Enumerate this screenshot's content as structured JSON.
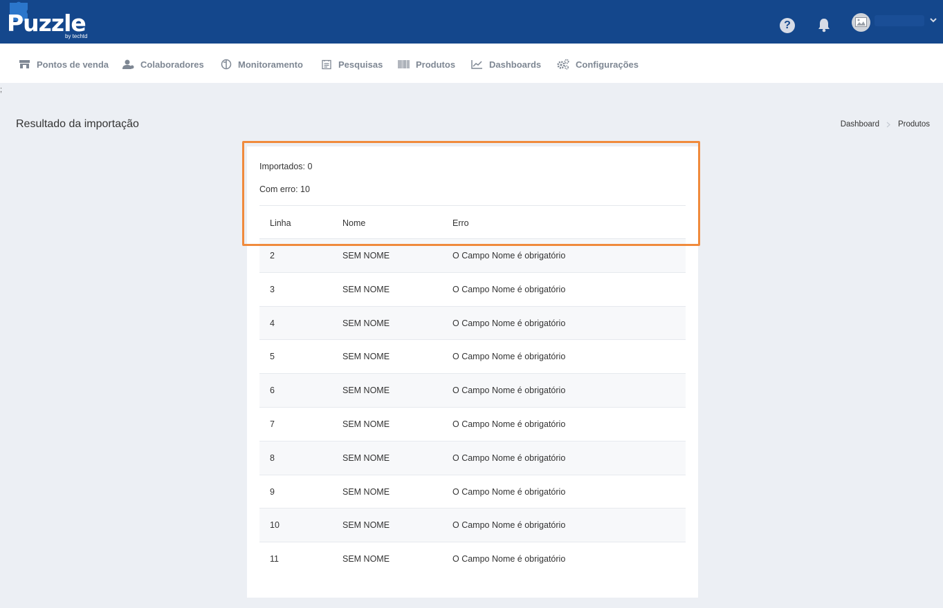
{
  "brand": {
    "name": "Puzzle",
    "tagline": "by techtd",
    "header_color": "#14478c",
    "accent_color": "#f08a3c"
  },
  "header": {
    "help_label": "?"
  },
  "nav": {
    "items": [
      {
        "label": "Pontos de venda",
        "icon": "store-icon"
      },
      {
        "label": "Colaboradores",
        "icon": "users-icon"
      },
      {
        "label": "Monitoramento",
        "icon": "monitor-icon"
      },
      {
        "label": "Pesquisas",
        "icon": "survey-icon"
      },
      {
        "label": "Produtos",
        "icon": "barcode-icon"
      },
      {
        "label": "Dashboards",
        "icon": "chart-icon"
      },
      {
        "label": "Configurações",
        "icon": "gears-icon"
      }
    ]
  },
  "stray_char": ";",
  "page": {
    "title": "Resultado da importação",
    "breadcrumb": [
      "Dashboard",
      "Produtos"
    ]
  },
  "summary": {
    "imported": "Importados: 0",
    "errors": "Com erro: 10"
  },
  "table": {
    "columns": [
      "Linha",
      "Nome",
      "Erro"
    ],
    "rows": [
      [
        "2",
        "SEM NOME",
        "O Campo Nome é obrigatório"
      ],
      [
        "3",
        "SEM NOME",
        "O Campo Nome é obrigatório"
      ],
      [
        "4",
        "SEM NOME",
        "O Campo Nome é obrigatório"
      ],
      [
        "5",
        "SEM NOME",
        "O Campo Nome é obrigatório"
      ],
      [
        "6",
        "SEM NOME",
        "O Campo Nome é obrigatório"
      ],
      [
        "7",
        "SEM NOME",
        "O Campo Nome é obrigatório"
      ],
      [
        "8",
        "SEM NOME",
        "O Campo Nome é obrigatório"
      ],
      [
        "9",
        "SEM NOME",
        "O Campo Nome é obrigatório"
      ],
      [
        "10",
        "SEM NOME",
        "O Campo Nome é obrigatório"
      ],
      [
        "11",
        "SEM NOME",
        "O Campo Nome é obrigatório"
      ]
    ]
  }
}
